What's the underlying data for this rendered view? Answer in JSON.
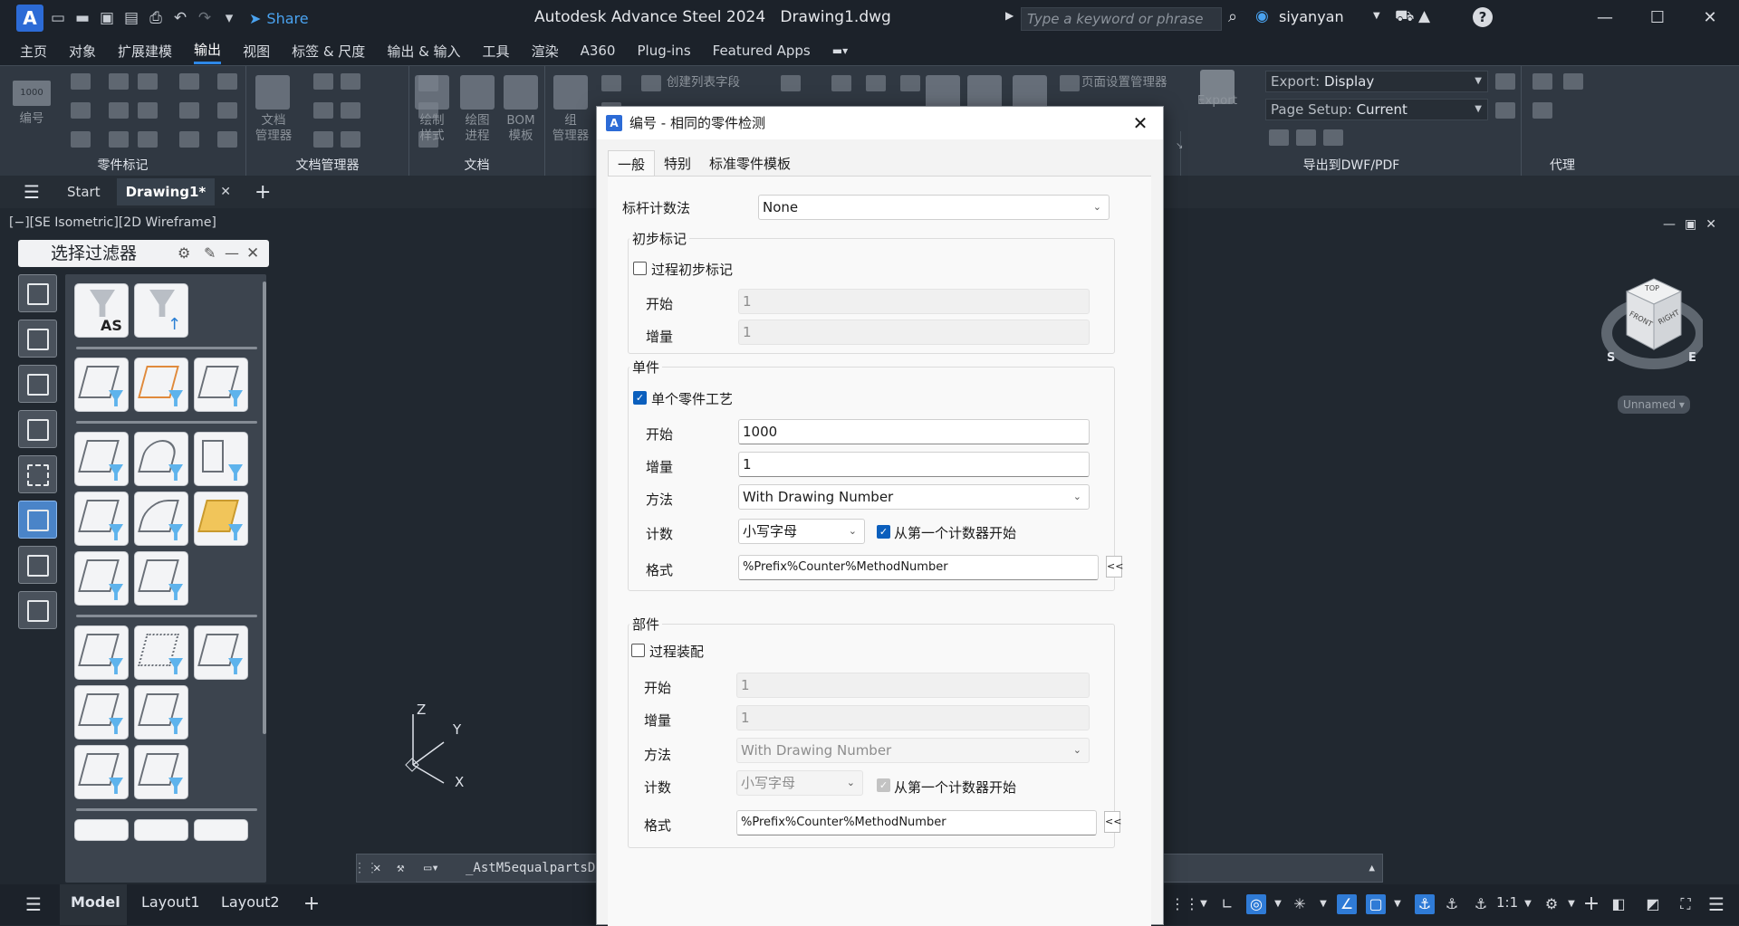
{
  "app": {
    "title": "Autodesk Advance Steel 2024",
    "document": "Drawing1.dwg",
    "share_label": "Share",
    "search_placeholder": "Type a keyword or phrase",
    "user": "siyanyan"
  },
  "menu": [
    "主页",
    "对象",
    "扩展建模",
    "输出",
    "视图",
    "标签 & 尺度",
    "输出 & 输入",
    "工具",
    "渲染",
    "A360",
    "Plug-ins",
    "Featured Apps"
  ],
  "ribbon": {
    "panels": [
      "零件标记",
      "文档管理器",
      "文档",
      "导出到DWF/PDF",
      "代理"
    ],
    "buttons": {
      "numbering_value": "1000",
      "numbering": "编号",
      "doc_manager_1": "文档",
      "doc_manager_2": "管理器",
      "draw_style_1": "绘制",
      "draw_style_2": "样式",
      "draw_process_1": "绘图",
      "draw_process_2": "进程",
      "bom_1": "BOM",
      "bom_2": "模板",
      "group_manager_1": "组",
      "group_manager_2": "管理器",
      "create_list_field": "创建列表字段",
      "page_setup_manager": "页面设置管理器",
      "export": "Export"
    },
    "export_combo": {
      "label": "Export:",
      "value": "Display"
    },
    "page_setup_combo": {
      "label": "Page Setup:",
      "value": "Current"
    }
  },
  "doc_tabs": {
    "start": "Start",
    "drawing": "Drawing1*"
  },
  "viewport_label": "[−][SE Isometric][2D Wireframe]",
  "viewcube": {
    "top": "TOP",
    "front": "FRONT",
    "right": "RIGHT",
    "s": "S",
    "e": "E",
    "unnamed": "Unnamed"
  },
  "ucs": {
    "z": "Z",
    "y": "Y",
    "x": "X"
  },
  "palette": {
    "title": "选择过滤器",
    "as_label": "AS"
  },
  "command_line": "_AstM5equalpartsDe",
  "layout_tabs": [
    "Model",
    "Layout1",
    "Layout2"
  ],
  "status": {
    "scale": "1:1"
  },
  "dialog": {
    "title": "编号 - 相同的零件检测",
    "tabs": [
      "一般",
      "特别",
      "标准零件模板"
    ],
    "bar_method_label": "标杆计数法",
    "bar_method_value": "None",
    "prelim": {
      "title": "初步标记",
      "check_label": "过程初步标记",
      "checked": false,
      "start_label": "开始",
      "start_value": "1",
      "increment_label": "增量",
      "increment_value": "1"
    },
    "single": {
      "title": "单件",
      "check_label": "单个零件工艺",
      "checked": true,
      "start_label": "开始",
      "start_value": "1000",
      "increment_label": "增量",
      "increment_value": "1",
      "method_label": "方法",
      "method_value": "With Drawing Number",
      "count_label": "计数",
      "count_value": "小写字母",
      "from_first_label": "从第一个计数器开始",
      "from_first_checked": true,
      "format_label": "格式",
      "format_value": "%Prefix%Counter%MethodNumber",
      "format_btn": "<<"
    },
    "assembly": {
      "title": "部件",
      "check_label": "过程装配",
      "checked": false,
      "start_label": "开始",
      "start_value": "1",
      "increment_label": "增量",
      "increment_value": "1",
      "method_label": "方法",
      "method_value": "With Drawing Number",
      "count_label": "计数",
      "count_value": "小写字母",
      "from_first_label": "从第一个计数器开始",
      "from_first_checked": true,
      "format_label": "格式",
      "format_value": "%Prefix%Counter%MethodNumber",
      "format_btn": "<<"
    }
  }
}
